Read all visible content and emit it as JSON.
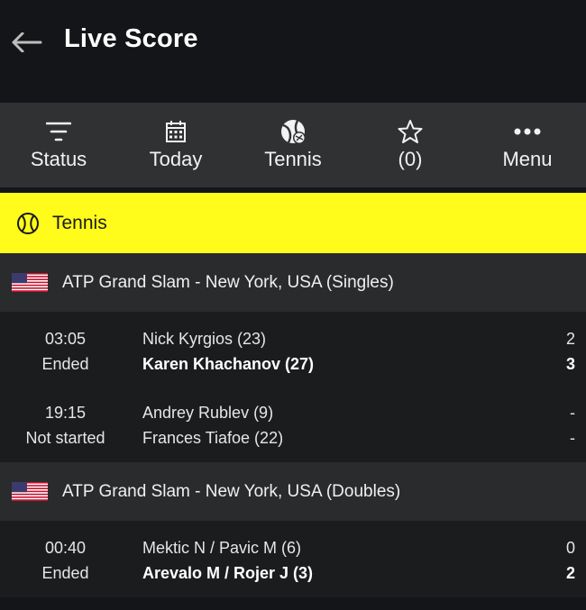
{
  "header": {
    "title": "Live Score",
    "back_icon": "arrow-left-icon"
  },
  "toolbar": {
    "items": [
      {
        "label": "Status",
        "icon": "filter-icon"
      },
      {
        "label": "Today",
        "icon": "calendar-icon"
      },
      {
        "label": "Tennis",
        "icon": "tennis-ball-icon"
      },
      {
        "label": "(0)",
        "icon": "star-icon"
      },
      {
        "label": "Menu",
        "icon": "more-dots-icon"
      }
    ]
  },
  "sport": {
    "label": "Tennis",
    "icon": "tennis-ball-icon",
    "color": "#fffb1a"
  },
  "tournaments": [
    {
      "name": "ATP Grand Slam - New York, USA (Singles)",
      "flag": "usa-flag-icon",
      "matches": [
        {
          "time": "03:05",
          "status": "Ended",
          "player1": "Nick Kyrgios (23)",
          "player2": "Karen Khachanov (27)",
          "score1": "2",
          "score2": "3",
          "winner": 2
        },
        {
          "time": "19:15",
          "status": "Not started",
          "player1": "Andrey Rublev (9)",
          "player2": "Frances Tiafoe (22)",
          "score1": "-",
          "score2": "-",
          "winner": 0
        }
      ]
    },
    {
      "name": "ATP Grand Slam - New York, USA (Doubles)",
      "flag": "usa-flag-icon",
      "matches": [
        {
          "time": "00:40",
          "status": "Ended",
          "player1": "Mektic N / Pavic M (6)",
          "player2": "Arevalo M / Rojer J (3)",
          "score1": "0",
          "score2": "2",
          "winner": 2
        }
      ]
    }
  ]
}
